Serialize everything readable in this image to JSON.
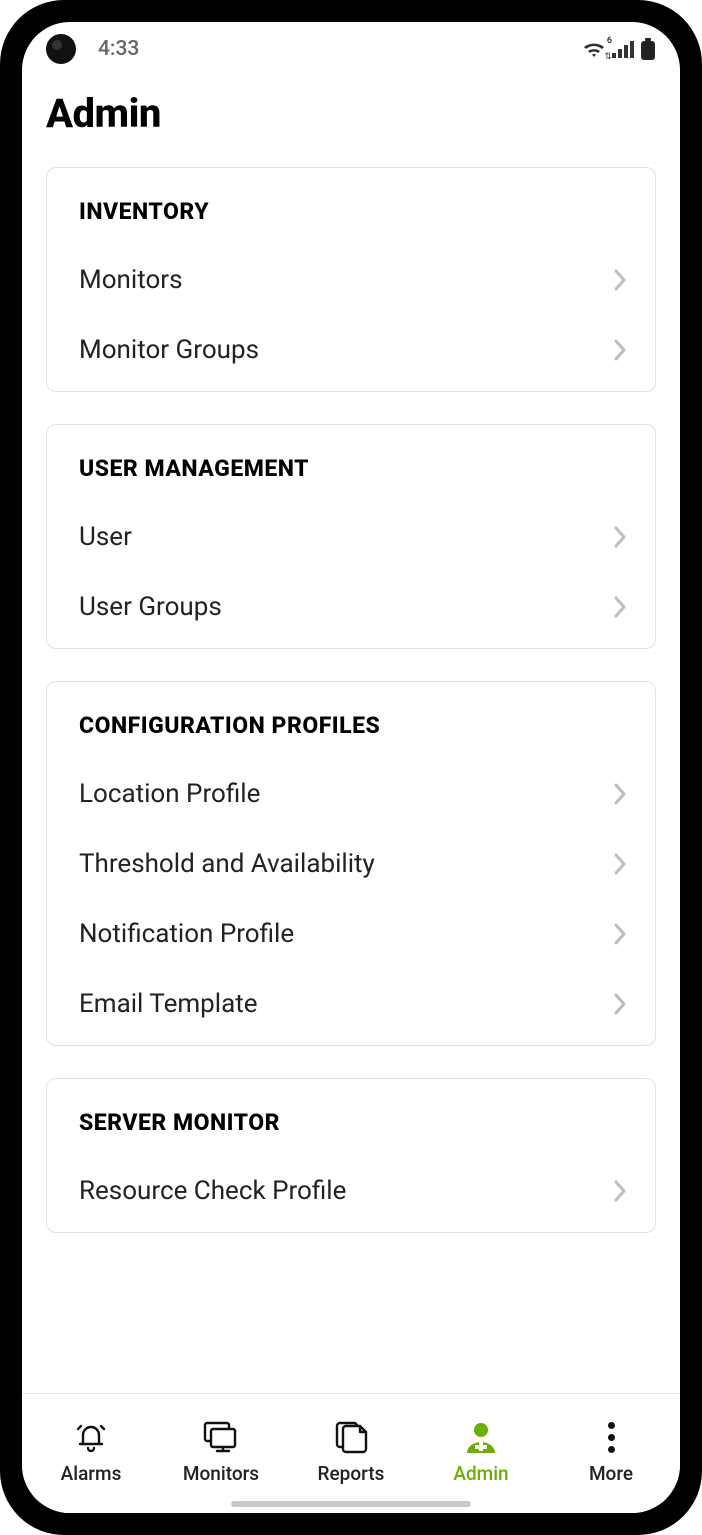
{
  "statusbar": {
    "time": "4:33"
  },
  "page": {
    "title": "Admin"
  },
  "sections": [
    {
      "heading": "INVENTORY",
      "items": [
        "Monitors",
        "Monitor Groups"
      ]
    },
    {
      "heading": "USER MANAGEMENT",
      "items": [
        "User",
        "User Groups"
      ]
    },
    {
      "heading": "CONFIGURATION PROFILES",
      "items": [
        "Location Profile",
        "Threshold and Availability",
        "Notification Profile",
        "Email Template"
      ]
    },
    {
      "heading": "SERVER MONITOR",
      "items": [
        "Resource Check Profile"
      ]
    }
  ],
  "nav": {
    "items": [
      {
        "label": "Alarms"
      },
      {
        "label": "Monitors"
      },
      {
        "label": "Reports"
      },
      {
        "label": "Admin"
      },
      {
        "label": "More"
      }
    ],
    "active_index": 3
  }
}
